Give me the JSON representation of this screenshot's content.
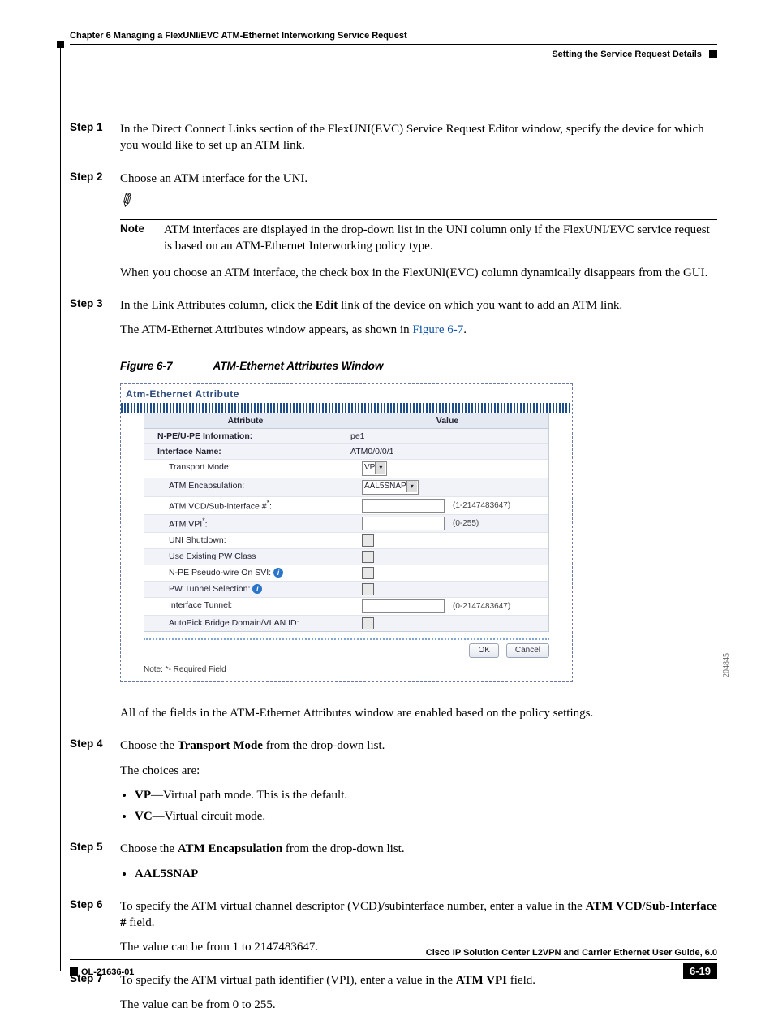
{
  "header": {
    "chapter": "Chapter 6      Managing a FlexUNI/EVC ATM-Ethernet Interworking Service Request",
    "section": "Setting the Service Request Details"
  },
  "steps": {
    "s1": {
      "label": "Step 1",
      "text": "In the Direct Connect Links section of the FlexUNI(EVC) Service Request Editor window, specify the device for which you would like to set up an ATM link."
    },
    "s2": {
      "label": "Step 2",
      "text": "Choose an ATM interface for the UNI."
    },
    "note": {
      "label": "Note",
      "text": "ATM interfaces are displayed in the drop-down list in the UNI column only if the FlexUNI/EVC service request is based on an ATM-Ethernet Interworking policy type."
    },
    "afterNote": "When you choose an ATM interface, the check box in the FlexUNI(EVC) column dynamically disappears from the GUI.",
    "s3": {
      "label": "Step 3",
      "p1a": "In the Link Attributes column, click the ",
      "p1b": "Edit",
      "p1c": " link of the device on which you want to add an ATM link.",
      "p2a": "The ATM-Ethernet Attributes window appears, as shown in ",
      "xref": "Figure 6-7",
      "p2b": "."
    },
    "afterFig": "All of the fields in the ATM-Ethernet Attributes window are enabled based on the policy settings.",
    "s4": {
      "label": "Step 4",
      "p1a": "Choose the ",
      "p1b": "Transport Mode",
      "p1c": " from the drop-down list.",
      "p2": "The choices are:",
      "li1a": "VP",
      "li1b": "—Virtual path mode. This is the default.",
      "li2a": "VC",
      "li2b": "—Virtual circuit mode."
    },
    "s5": {
      "label": "Step 5",
      "p1a": "Choose the ",
      "p1b": "ATM Encapsulation",
      "p1c": " from the drop-down list.",
      "li1": "AAL5SNAP"
    },
    "s6": {
      "label": "Step 6",
      "p1a": "To specify the ATM virtual channel descriptor (VCD)/subinterface number, enter a value in the ",
      "p1b": "ATM VCD/Sub-Interface #",
      "p1c": " field.",
      "p2": "The value can be from 1 to 2147483647."
    },
    "s7": {
      "label": "Step 7",
      "p1a": "To specify the ATM virtual path identifier (VPI), enter a value in the ",
      "p1b": "ATM VPI",
      "p1c": " field.",
      "p2": "The value can be from 0 to 255."
    }
  },
  "figure": {
    "caption_num": "Figure 6-7",
    "caption_title": "ATM-Ethernet Attributes Window",
    "panel_title": "Atm-Ethernet Attribute",
    "col_attr": "Attribute",
    "col_val": "Value",
    "rows": {
      "r0a": "N-PE/U-PE Information:",
      "r0v": "pe1",
      "r1a": "Interface Name:",
      "r1v": "ATM0/0/0/1",
      "r2a": "Transport Mode:",
      "r2v": "VP",
      "r3a": "ATM Encapsulation:",
      "r3v": "AAL5SNAP",
      "r4a": "ATM VCD/Sub-interface #",
      "r4h": "(1-2147483647)",
      "r5a": "ATM VPI",
      "r5h": "(0-255)",
      "r6a": "UNI Shutdown:",
      "r7a": "Use Existing PW Class",
      "r8a": "N-PE Pseudo-wire On SVI:",
      "r9a": "PW Tunnel Selection:",
      "r10a": "Interface Tunnel:",
      "r10h": "(0-2147483647)",
      "r11a": "AutoPick Bridge Domain/VLAN ID:"
    },
    "ok": "OK",
    "cancel": "Cancel",
    "reqnote": "Note: *- Required Field",
    "sidetag": "204845"
  },
  "footer": {
    "title": "Cisco IP Solution Center L2VPN and Carrier Ethernet User Guide, 6.0",
    "docnum": "OL-21636-01",
    "pagenum": "6-19"
  }
}
